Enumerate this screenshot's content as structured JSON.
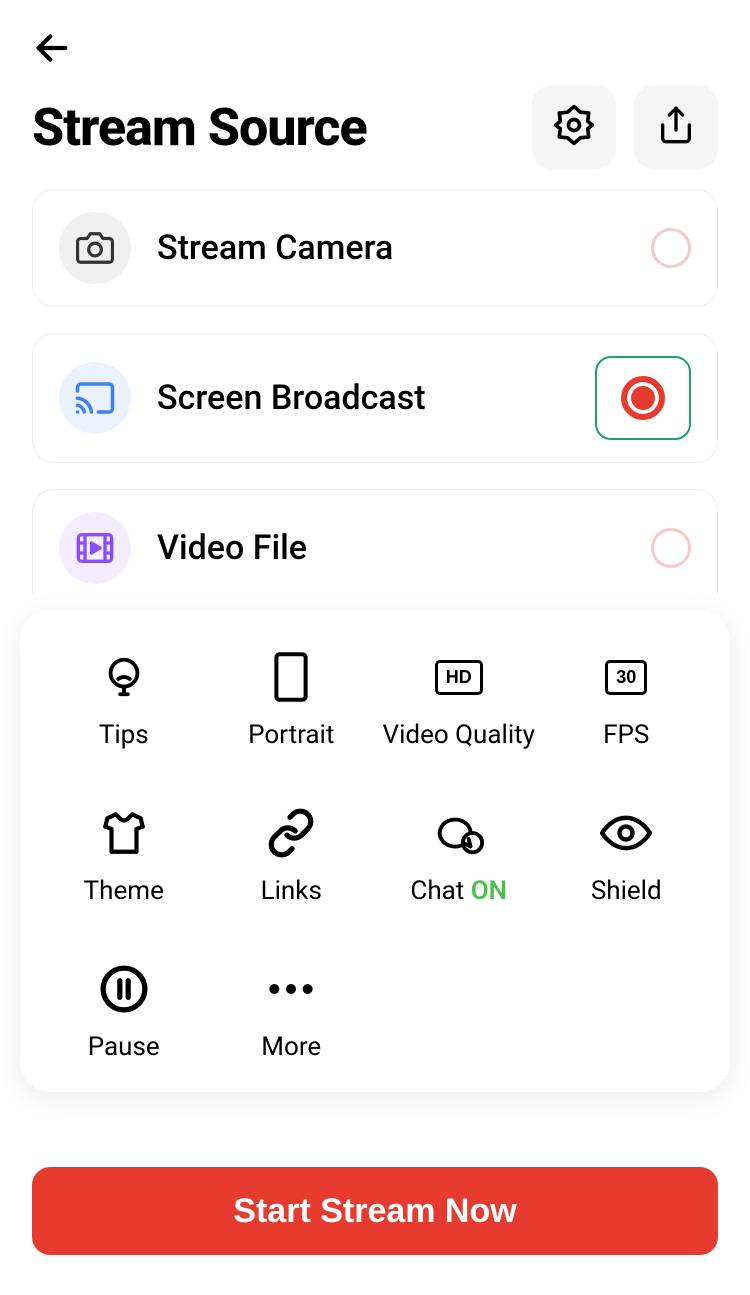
{
  "header": {
    "title": "Stream Source"
  },
  "sources": [
    {
      "label": "Stream Camera",
      "selected": false
    },
    {
      "label": "Screen Broadcast",
      "selected": true
    },
    {
      "label": "Video File",
      "selected": false
    }
  ],
  "grid": {
    "tips": "Tips",
    "portrait": "Portrait",
    "video_quality": "Video Quality",
    "video_quality_badge": "HD",
    "fps": "FPS",
    "fps_badge": "30",
    "theme": "Theme",
    "links": "Links",
    "chat_prefix": "Chat ",
    "chat_status": "ON",
    "shield": "Shield",
    "pause": "Pause",
    "more": "More"
  },
  "cta": {
    "start": "Start Stream Now"
  }
}
